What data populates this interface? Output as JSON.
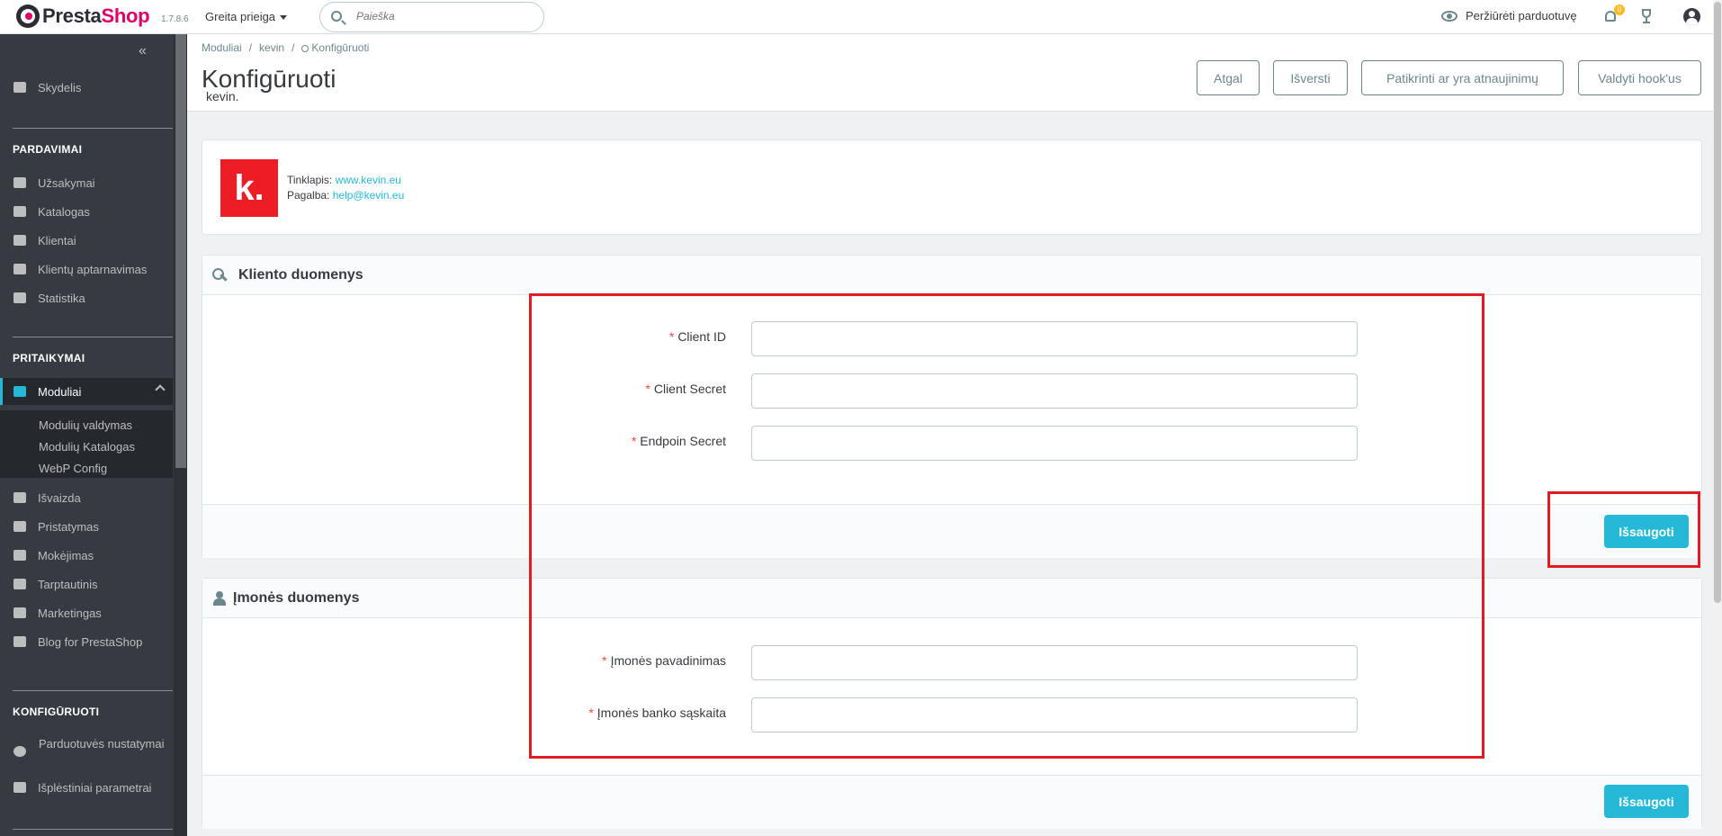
{
  "topbar": {
    "logo_part1": "Presta",
    "logo_part2": "Shop",
    "version": "1.7.8.6",
    "quick_access": "Greita prieiga",
    "search_placeholder": "Paieška",
    "view_shop": "Peržiūrėti parduotuvę",
    "notifications_count": "0"
  },
  "sidebar": {
    "collapse": "«",
    "dashboard": "Skydelis",
    "sales_header": "PARDAVIMAI",
    "orders": "Užsakymai",
    "catalog": "Katalogas",
    "customers": "Klientai",
    "customer_service": "Klientų aptarnavimas",
    "stats": "Statistika",
    "improve_header": "PRITAIKYMAI",
    "modules": "Moduliai",
    "module_manager": "Modulių valdymas",
    "module_catalog": "Modulių Katalogas",
    "webp": "WebP Config",
    "design": "Išvaizda",
    "shipping": "Pristatymas",
    "payment": "Mokėjimas",
    "international": "Tarptautinis",
    "marketing": "Marketingas",
    "blog": "Blog for PrestaShop",
    "configure_header": "KONFIGŪRUOTI",
    "shop_params": "Parduotuvės nustatymai",
    "advanced_params": "Išplėstiniai parametrai"
  },
  "header": {
    "breadcrumb": [
      "Moduliai",
      "kevin",
      "Konfigūruoti"
    ],
    "title": "Konfigūruoti",
    "subtitle": "kevin.",
    "buttons": {
      "back": "Atgal",
      "translate": "Išversti",
      "check_update": "Patikrinti ar yra atnaujinimų",
      "manage_hooks": "Valdyti hook'us"
    }
  },
  "module_info": {
    "logo_text": "k.",
    "website_label": "Tinklapis:",
    "website": "www.kevin.eu",
    "support_label": "Pagalba:",
    "support": "help@kevin.eu"
  },
  "client_panel": {
    "title": "Kliento duomenys",
    "fields": [
      {
        "label": "Client ID",
        "value": ""
      },
      {
        "label": "Client Secret",
        "value": ""
      },
      {
        "label": "Endpoin Secret",
        "value": ""
      }
    ],
    "save": "Išsaugoti"
  },
  "company_panel": {
    "title": "Įmonės duomenys",
    "fields": [
      {
        "label": "Įmonės pavadinimas",
        "value": ""
      },
      {
        "label": "Įmonės banko sąskaita",
        "value": ""
      }
    ],
    "save": "Išsaugoti"
  },
  "required_mark": "*",
  "colors": {
    "accent": "#25b9d7",
    "sidebar": "#363a41",
    "highlight": "#e01b23",
    "brand_red": "#ee1c25"
  }
}
